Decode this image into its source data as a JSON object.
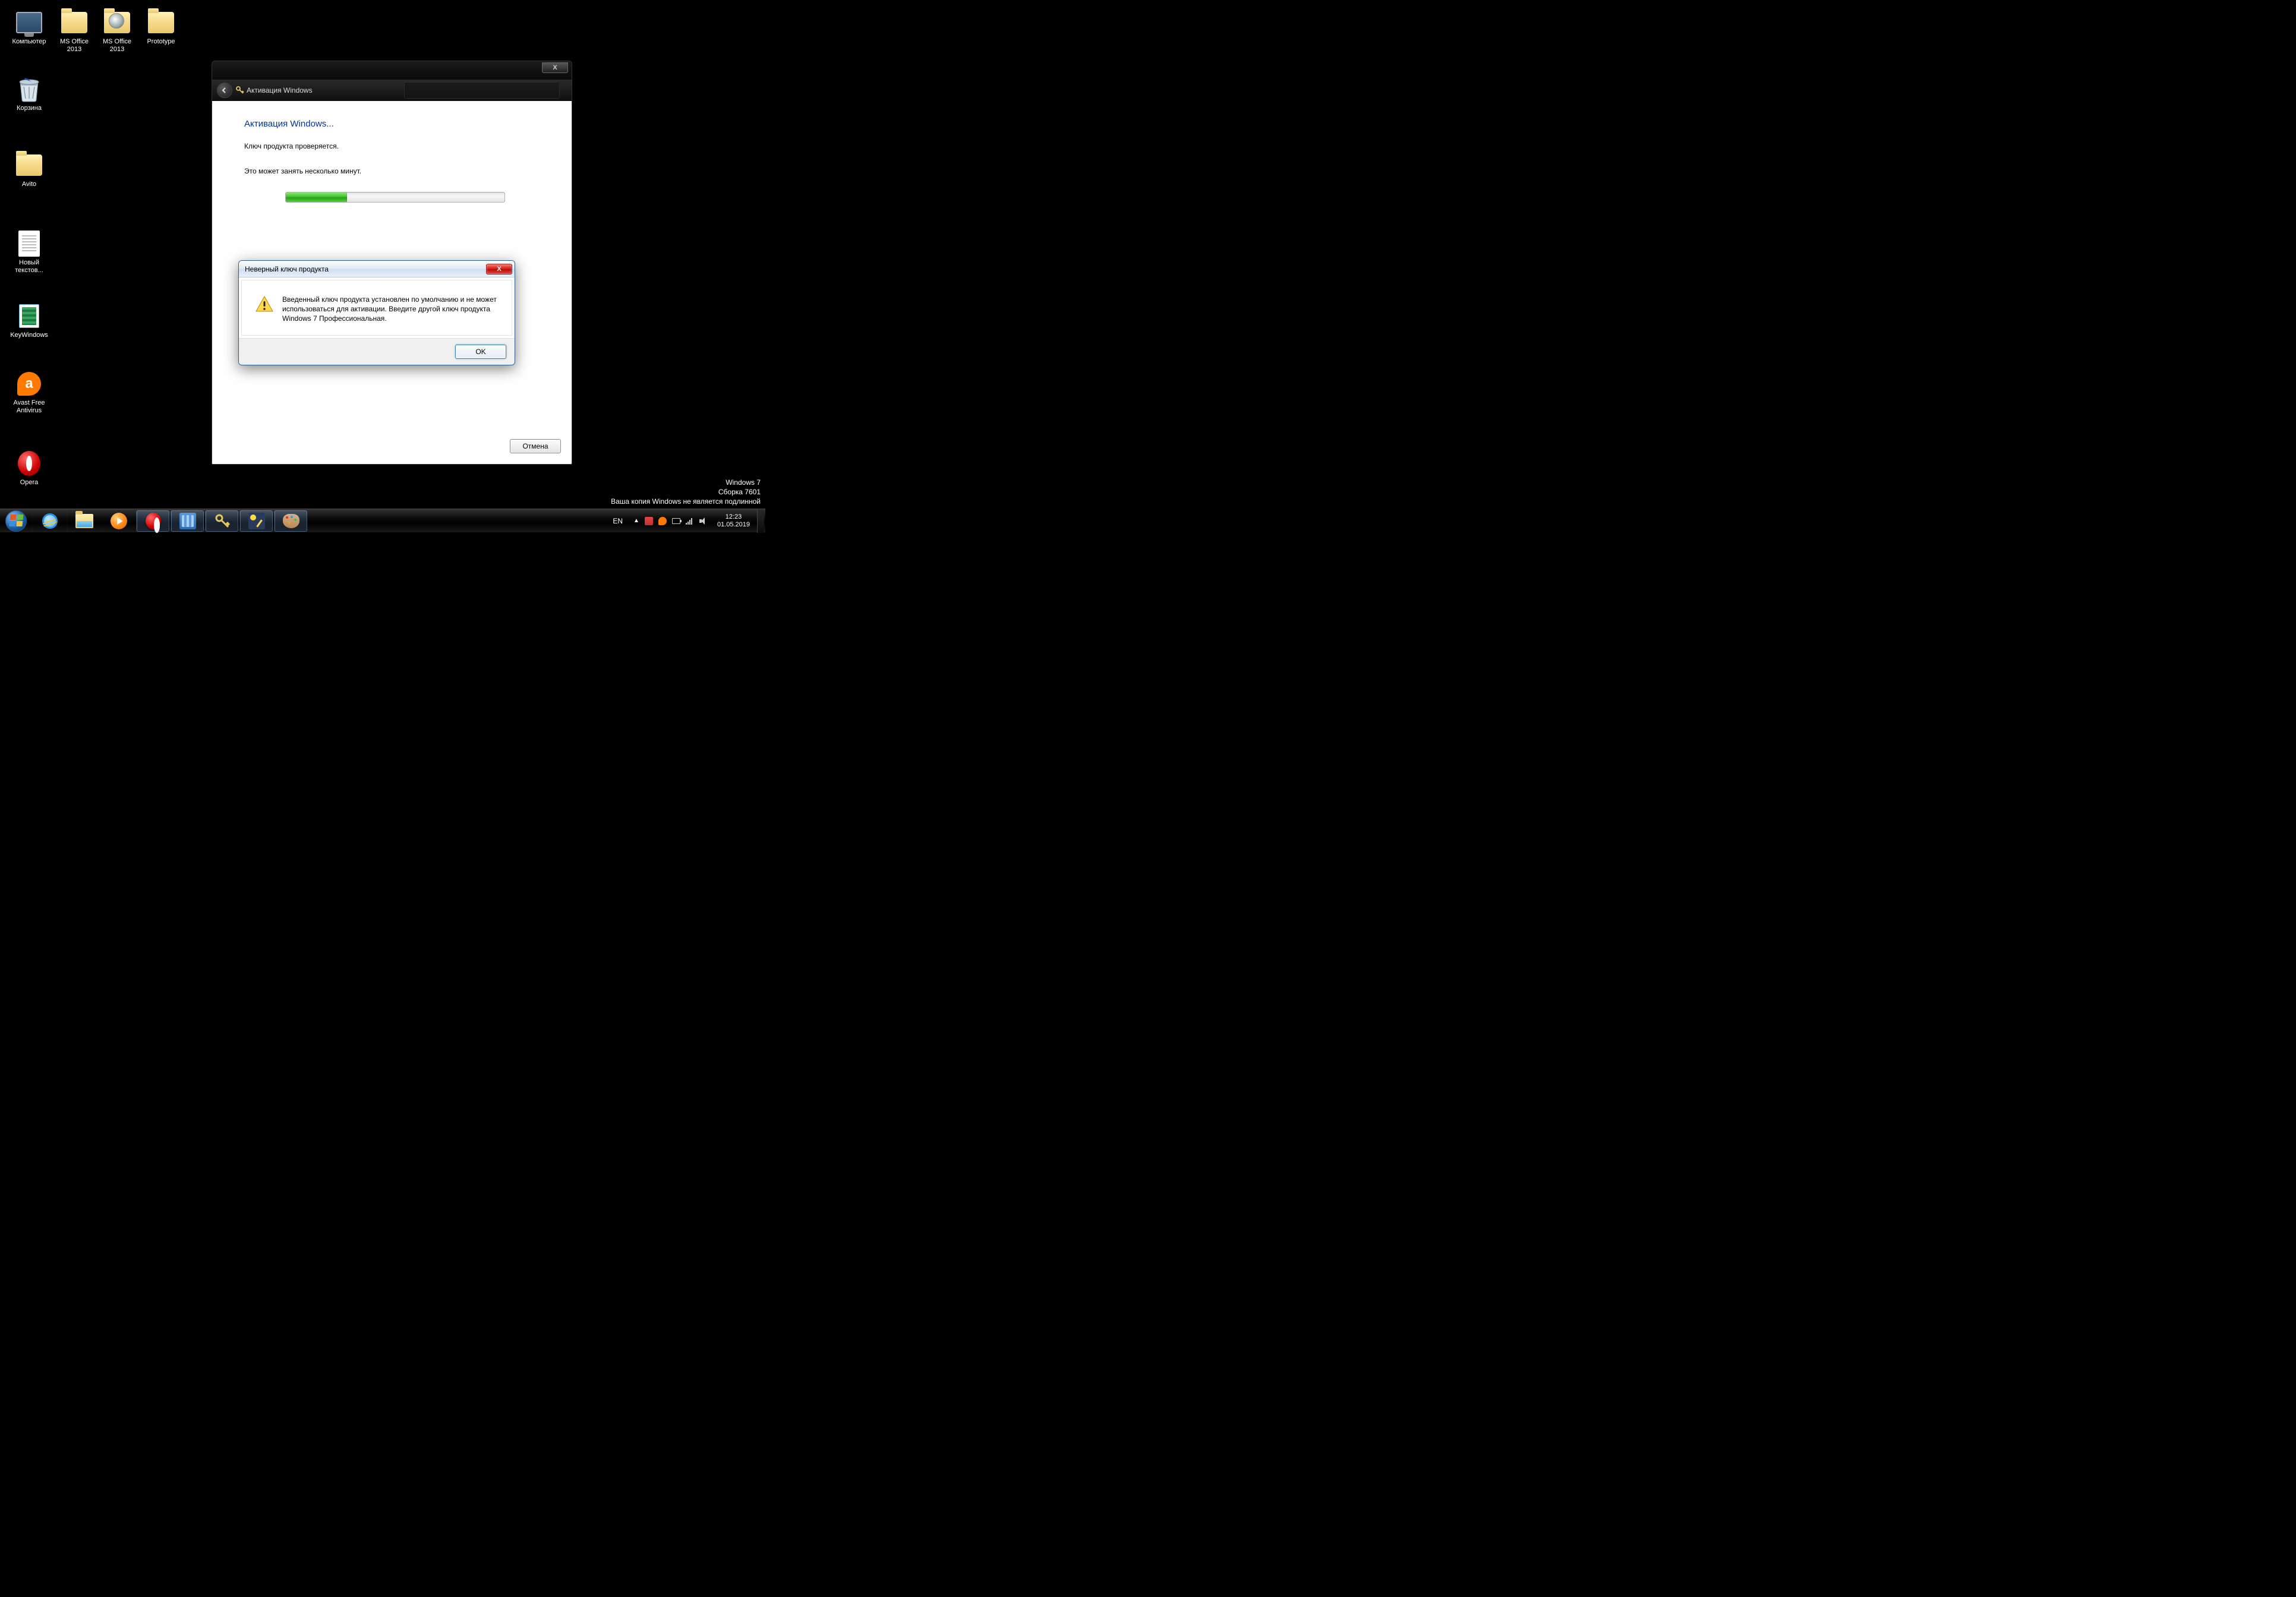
{
  "desktop": {
    "icons": [
      {
        "label": "Компьютер"
      },
      {
        "label": "MS Office 2013"
      },
      {
        "label": "MS Office 2013"
      },
      {
        "label": "Prototype"
      },
      {
        "label": "Корзина"
      },
      {
        "label": "Avito"
      },
      {
        "label": "Новый текстов..."
      },
      {
        "label": "KeyWindows"
      },
      {
        "label": "Avast Free Antivirus"
      },
      {
        "label": "Opera"
      }
    ]
  },
  "watermark": {
    "line1": "Windows 7",
    "line2": "Сборка 7601",
    "line3": "Ваша копия Windows не является подлинной"
  },
  "activation": {
    "nav_title": "Активация Windows",
    "heading": "Активация Windows...",
    "line1": "Ключ продукта проверяется.",
    "line2": "Это может занять несколько минут.",
    "cancel": "Отмена",
    "close_x": "X"
  },
  "dialog": {
    "title": "Неверный ключ продукта",
    "message": "Введенный ключ продукта установлен по умолчанию и не может использоваться для активации. Введите другой ключ продукта Windows 7 Профессиональная.",
    "ok": "OK",
    "close_x": "X"
  },
  "taskbar": {
    "lang": "EN",
    "time": "12:23",
    "date": "01.05.2019"
  }
}
